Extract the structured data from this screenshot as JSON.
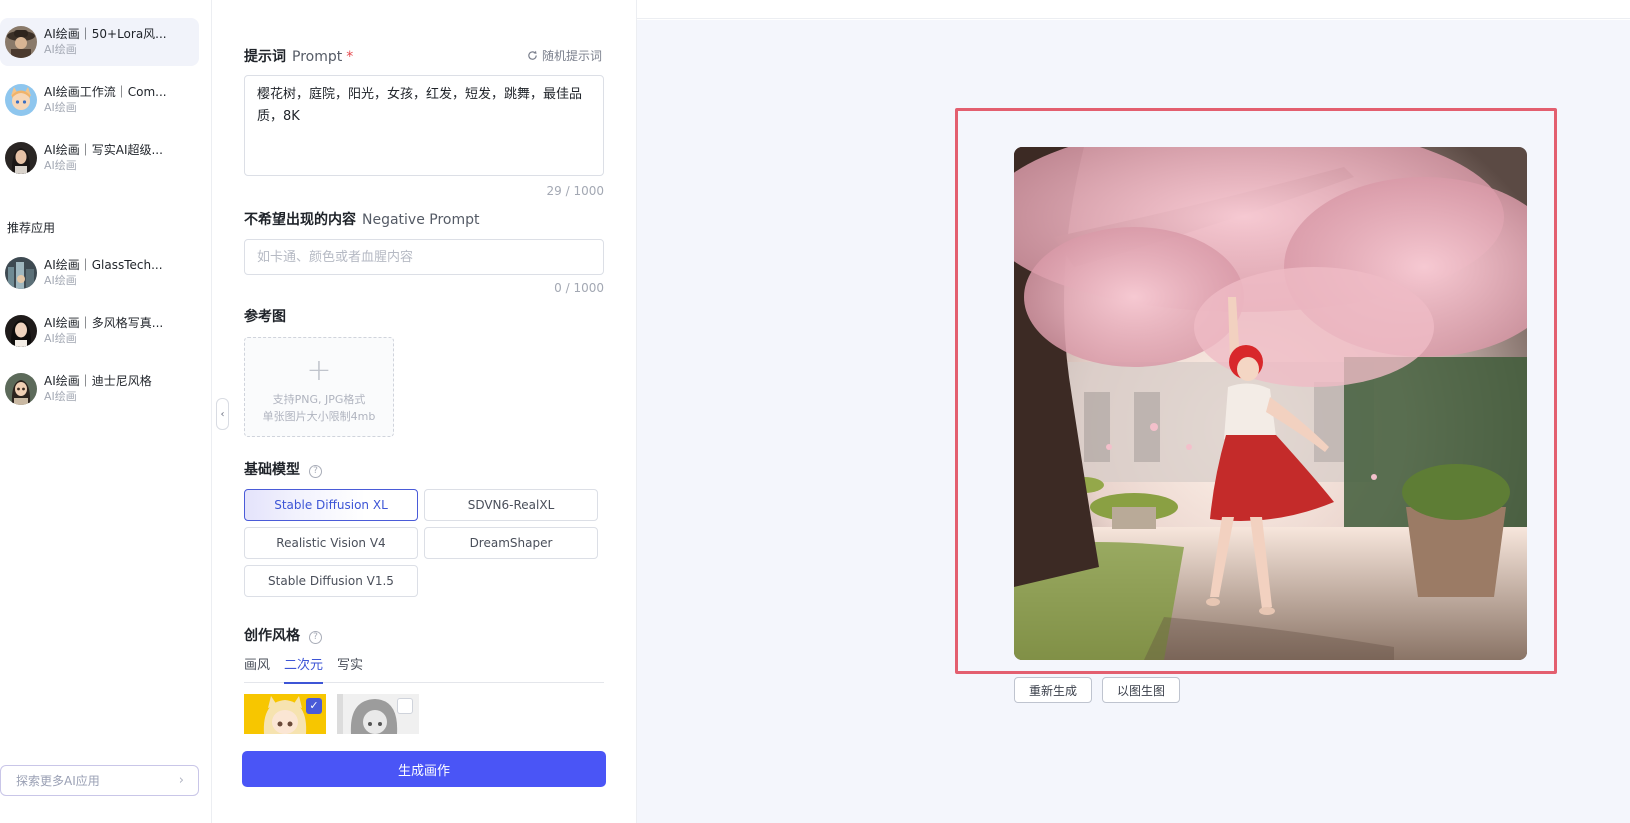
{
  "sidebar": {
    "recent_apps": [
      {
        "title": "AI绘画｜50+Lora风...",
        "subtitle": "AI绘画",
        "avatar_icon": "avatar-cowboy-icon"
      },
      {
        "title": "AI绘画工作流｜Com...",
        "subtitle": "AI绘画",
        "avatar_icon": "avatar-cat-girl-icon"
      },
      {
        "title": "AI绘画｜写实AI超级...",
        "subtitle": "AI绘画",
        "avatar_icon": "avatar-portrait-icon"
      }
    ],
    "recommended_title": "推荐应用",
    "recommended_apps": [
      {
        "title": "AI绘画｜GlassTech...",
        "subtitle": "AI绘画",
        "avatar_icon": "avatar-city-icon"
      },
      {
        "title": "AI绘画｜多风格写真...",
        "subtitle": "AI绘画",
        "avatar_icon": "avatar-woman-icon"
      },
      {
        "title": "AI绘画｜迪士尼风格",
        "subtitle": "AI绘画",
        "avatar_icon": "avatar-disney-icon"
      }
    ],
    "explore_label": "探索更多AI应用",
    "explore_chevron": "›"
  },
  "form": {
    "prompt": {
      "label": "提示词",
      "label_en": "Prompt",
      "required_mark": "*",
      "random_label": "随机提示词",
      "value": "樱花树，庭院，阳光，女孩，红发，短发，跳舞，最佳品质，8K",
      "counter": "29 / 1000"
    },
    "negative": {
      "label": "不希望出现的内容",
      "label_en": "Negative Prompt",
      "placeholder": "如卡通、颜色或者血腥内容",
      "counter": "0 / 1000"
    },
    "reference": {
      "label": "参考图",
      "plus": "+",
      "hint_line1": "支持PNG, JPG格式",
      "hint_line2": "单张图片大小限制4mb"
    },
    "base_model": {
      "label": "基础模型",
      "help": "?",
      "options": [
        "Stable Diffusion XL",
        "SDVN6-RealXL",
        "Realistic Vision V4",
        "DreamShaper",
        "Stable Diffusion V1.5"
      ],
      "selected": "Stable Diffusion XL"
    },
    "style": {
      "label": "创作风格",
      "help": "?",
      "tabs": [
        "画风",
        "二次元",
        "写实"
      ],
      "active_tab": "二次元",
      "check_mark": "✓"
    },
    "generate_label": "生成画作",
    "collapse_glyph": "‹"
  },
  "preview": {
    "regenerate_label": "重新生成",
    "img2img_label": "以图生图"
  },
  "colors": {
    "accent": "#4a55f6",
    "tab_active": "#3d55d6",
    "highlight_frame": "#e35f6f",
    "preview_bg": "#f4f6fc"
  }
}
